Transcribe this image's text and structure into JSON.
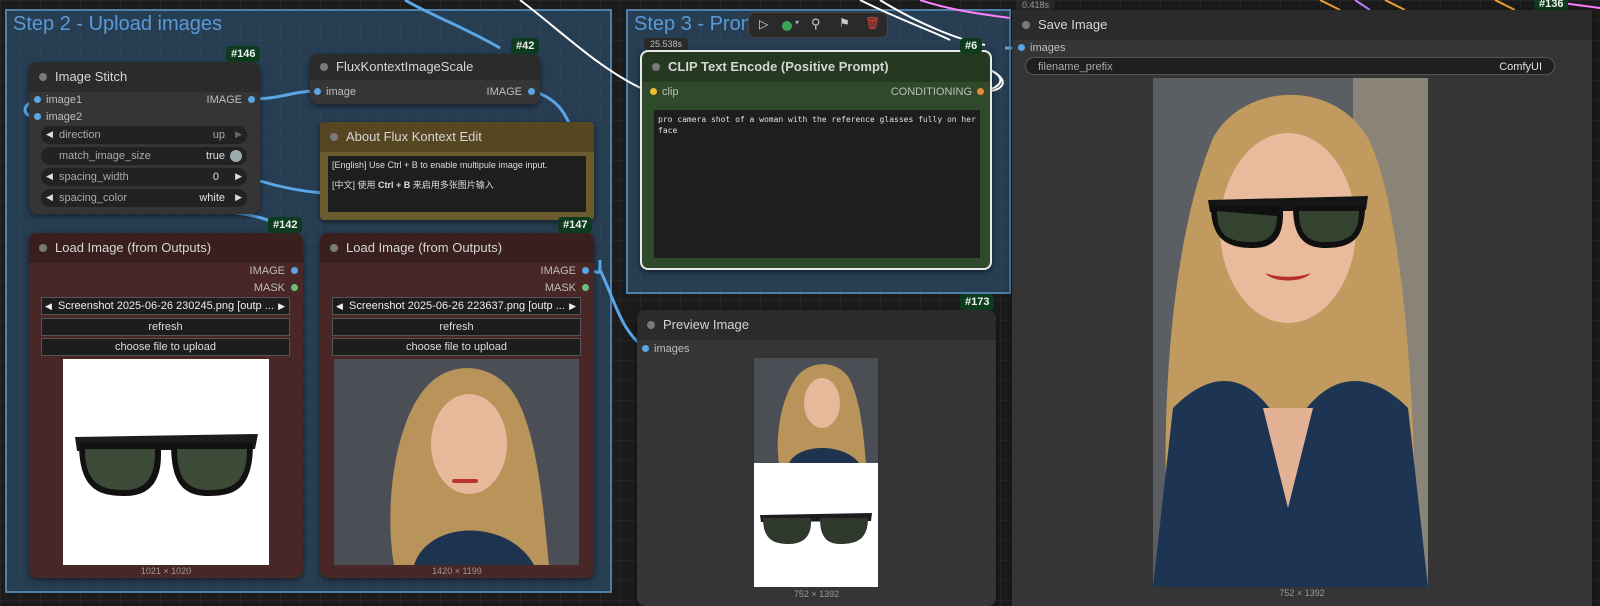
{
  "groups": {
    "step2": "Step 2 - Upload images",
    "step3": "Step 3 - Prom"
  },
  "toolbar": {
    "timer": "25.538s",
    "run_icon": "play-icon",
    "color_icon": "color-dot-icon",
    "bypass_icon": "wand-icon",
    "pin_icon": "pin-icon",
    "delete_icon": "trash-icon",
    "accent": "#3aa655",
    "delete_color": "#e04040"
  },
  "image_stitch": {
    "id": "#146",
    "title": "Image Stitch",
    "inputs": [
      "image1",
      "image2"
    ],
    "output": "IMAGE",
    "widgets": [
      {
        "label": "direction",
        "value": "up"
      },
      {
        "label": "match_image_size",
        "value": "true"
      },
      {
        "label": "spacing_width",
        "value": "0"
      },
      {
        "label": "spacing_color",
        "value": "white"
      }
    ]
  },
  "flux_scale": {
    "id": "#42",
    "title": "FluxKontextImageScale",
    "input": "image",
    "output": "IMAGE"
  },
  "about_note": {
    "title": "About Flux Kontext Edit",
    "line1": "[English] Use Ctrl + B to enable multipule image input.",
    "line2_prefix": "[中文] 使用 ",
    "line2_bold": "Ctrl + B",
    "line2_suffix": " 来启用多张图片输入"
  },
  "load_image_1": {
    "id": "#142",
    "title": "Load Image (from Outputs)",
    "outputs": [
      "IMAGE",
      "MASK"
    ],
    "file": "Screenshot 2025-06-26 230245.png [outp ...",
    "refresh": "refresh",
    "upload": "choose file to upload",
    "dims": "1021 × 1020"
  },
  "load_image_2": {
    "id": "#147",
    "title": "Load Image (from Outputs)",
    "outputs": [
      "IMAGE",
      "MASK"
    ],
    "file": "Screenshot 2025-06-26 223637.png [outp ...",
    "refresh": "refresh",
    "upload": "choose file to upload",
    "dims": "1420 × 1199"
  },
  "clip_encode": {
    "id": "#6",
    "title": "CLIP Text Encode (Positive Prompt)",
    "input": "clip",
    "output": "CONDITIONING",
    "prompt": "pro camera shot of a woman with the reference glasses fully on her face"
  },
  "preview_image": {
    "id": "#173",
    "title": "Preview Image",
    "input": "images",
    "dims": "752 × 1392"
  },
  "save_image": {
    "timer": "0.418s",
    "id": "#136",
    "title": "Save Image",
    "input": "images",
    "widget_label": "filename_prefix",
    "widget_value": "ComfyUI",
    "dims": "752 × 1392"
  }
}
